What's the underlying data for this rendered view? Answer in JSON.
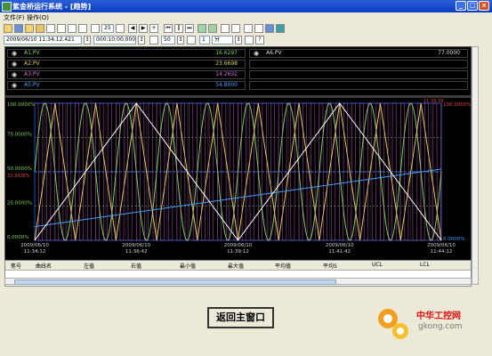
{
  "window": {
    "title": "紫金桥运行系统 - [趋势]",
    "minimize": "_",
    "maximize": "□",
    "close": "×"
  },
  "menu": {
    "file": "文件(F)",
    "edit": "操作(O)"
  },
  "toolbar2": {
    "start_time": "2009/06/10 11:34:12.421",
    "duration": "000:10:00.000",
    "rate": "50",
    "count": "1",
    "unit": "分"
  },
  "toolbar1": {
    "interval": "25"
  },
  "legend": [
    {
      "name": "A1.PV",
      "value": "16.6297",
      "color": "#7dd35a"
    },
    {
      "name": "A2.PV",
      "value": "23.6698",
      "color": "#e0d050"
    },
    {
      "name": "A3.PV",
      "value": "14.2632",
      "color": "#e060e0"
    },
    {
      "name": "A5.PV",
      "value": "54.8000",
      "color": "#40a0ff"
    },
    {
      "name": "A6.PV",
      "value": "77.0000",
      "color": "#ffffff"
    }
  ],
  "chart": {
    "y_axis_labels": [
      "100.0000%",
      "75.0000%",
      "50.0000%",
      "25.0000%",
      "0.0000%"
    ],
    "cursor_value_left": "33.3438%",
    "right_top": "100.0000%",
    "right_bottom": "0.0000%",
    "top_marker": "11:39:39",
    "x_axis_labels": [
      {
        "date": "2009/06/10",
        "time": "11:34:12"
      },
      {
        "date": "2009/06/10",
        "time": "11:36:42"
      },
      {
        "date": "2009/06/10",
        "time": "11:39:12"
      },
      {
        "date": "2009/06/10",
        "time": "11:41:42"
      },
      {
        "date": "2009/06/10",
        "time": "11:44:12"
      }
    ]
  },
  "chart_data": {
    "type": "line",
    "y_range": [
      0,
      100
    ],
    "x_range": [
      "11:34:12",
      "11:44:12"
    ],
    "series": [
      {
        "name": "A1.PV",
        "color": "#7dd35a",
        "shape": "sine",
        "period_fraction": 0.1
      },
      {
        "name": "A2.PV",
        "color": "#e0d050",
        "shape": "triangle",
        "period_fraction": 0.1
      },
      {
        "name": "A3.PV",
        "color": "#e060e0",
        "shape": "square",
        "period_fraction": 0.02
      },
      {
        "name": "A5.PV",
        "color": "#40a0ff",
        "shape": "ramp",
        "from": 10,
        "to": 52
      },
      {
        "name": "A6.PV",
        "color": "#ffffff",
        "shape": "triangle",
        "period_fraction": 0.5
      }
    ],
    "grid": true
  },
  "table": {
    "headers": [
      "笔号",
      "曲线名",
      "左值",
      "右值",
      "最小值",
      "最大值",
      "平均值",
      "平均S",
      "UCL",
      "LCL"
    ]
  },
  "back_button": "返回主窗口",
  "watermark": {
    "text1": "中华工控网",
    "text2": "gkong.com"
  }
}
